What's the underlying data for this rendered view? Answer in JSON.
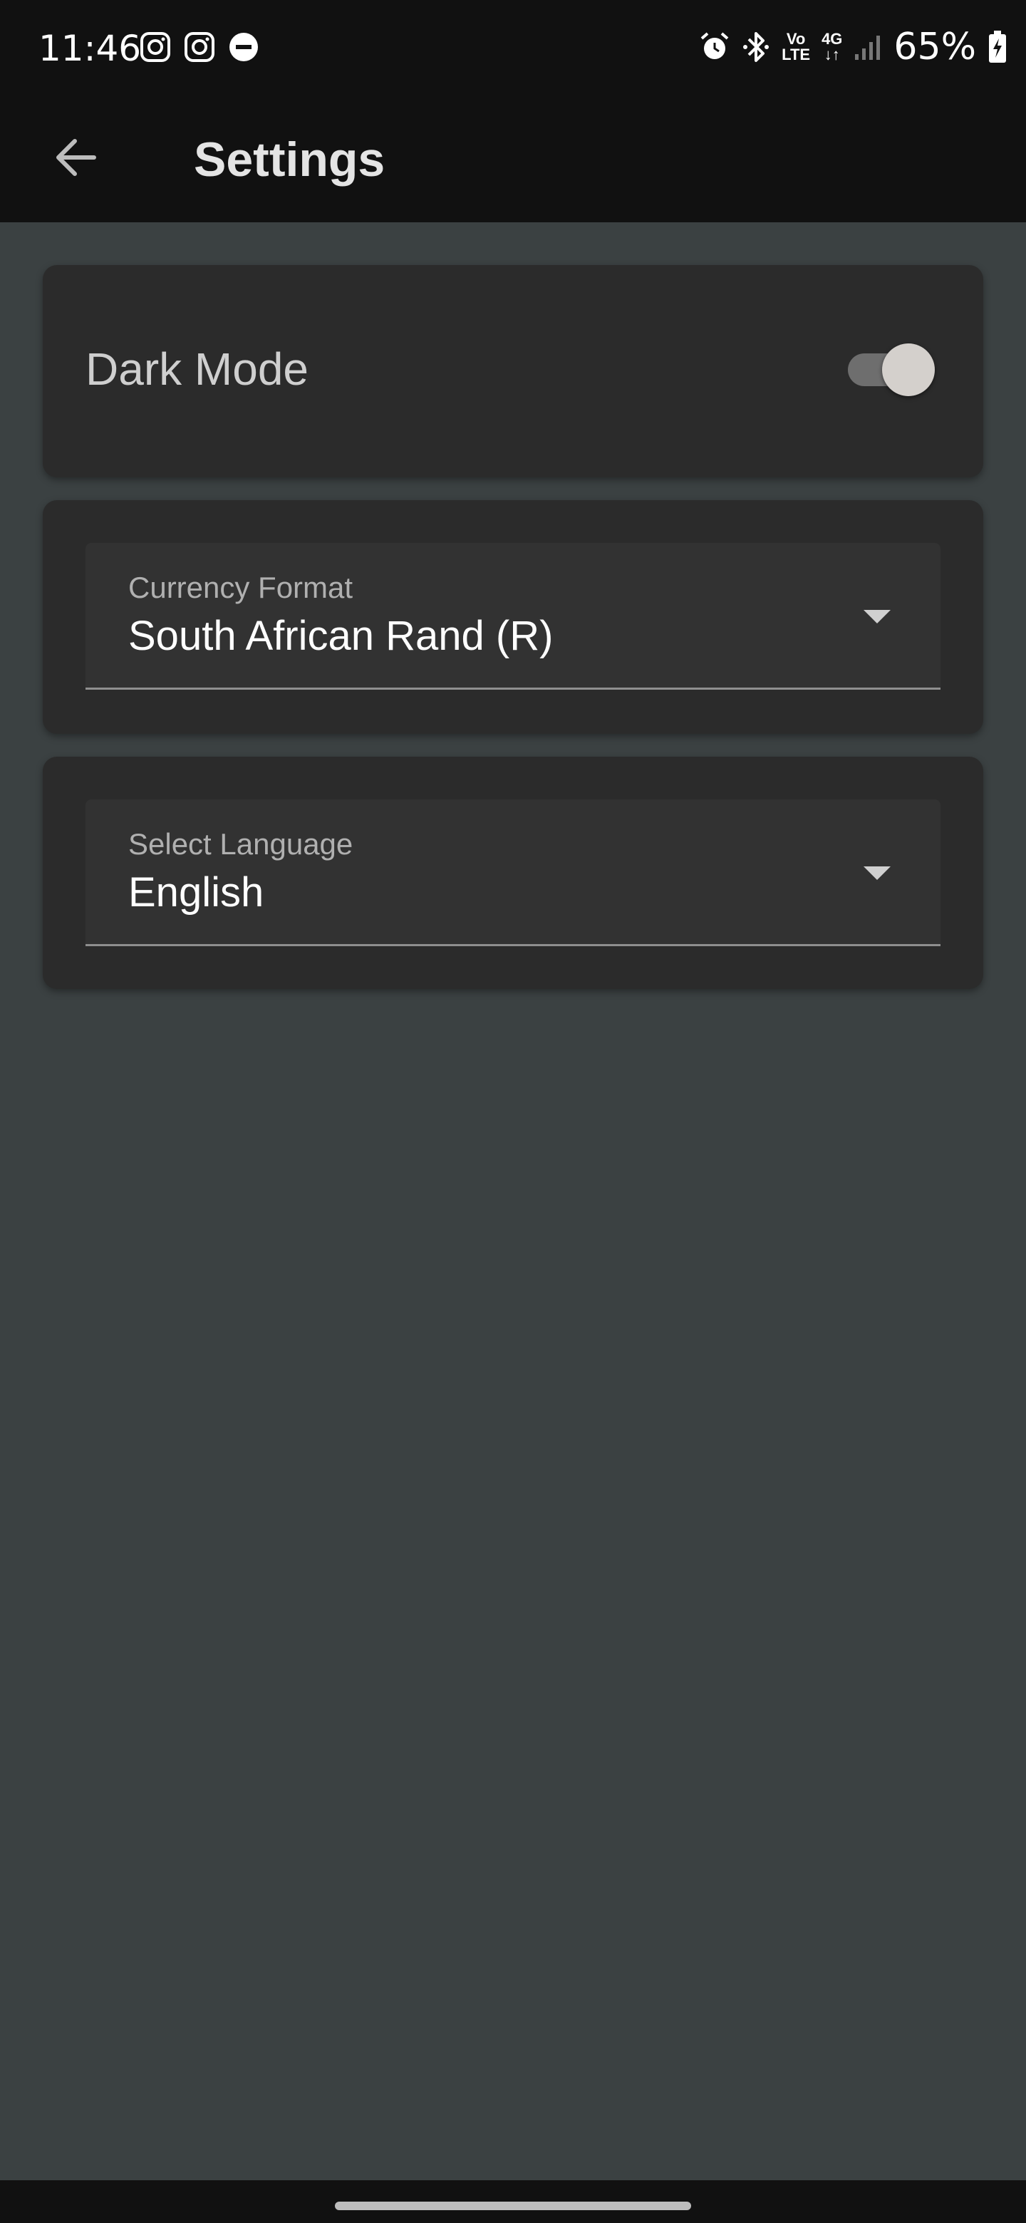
{
  "status_bar": {
    "time": "11:46",
    "battery": "65%",
    "network_volte": [
      "Vo",
      "LTE"
    ],
    "network_4g": [
      "4G",
      "↓↑"
    ],
    "left_icons": [
      "instagram-icon",
      "instagram-icon",
      "do-not-disturb-icon"
    ],
    "right_icons": [
      "alarm-icon",
      "bluetooth-icon",
      "volte-icon",
      "4g-icon",
      "signal-icon",
      "battery-charging-icon"
    ]
  },
  "app_bar": {
    "title": "Settings",
    "back_icon": "arrow-back-icon"
  },
  "settings": {
    "dark_mode": {
      "label": "Dark Mode",
      "enabled": true
    },
    "currency": {
      "label": "Currency Format",
      "value": "South African Rand (R)"
    },
    "language": {
      "label": "Select Language",
      "value": "English"
    }
  },
  "colors": {
    "background": "#3b4142",
    "card": "#2b2b2b",
    "bars": "#111111"
  }
}
